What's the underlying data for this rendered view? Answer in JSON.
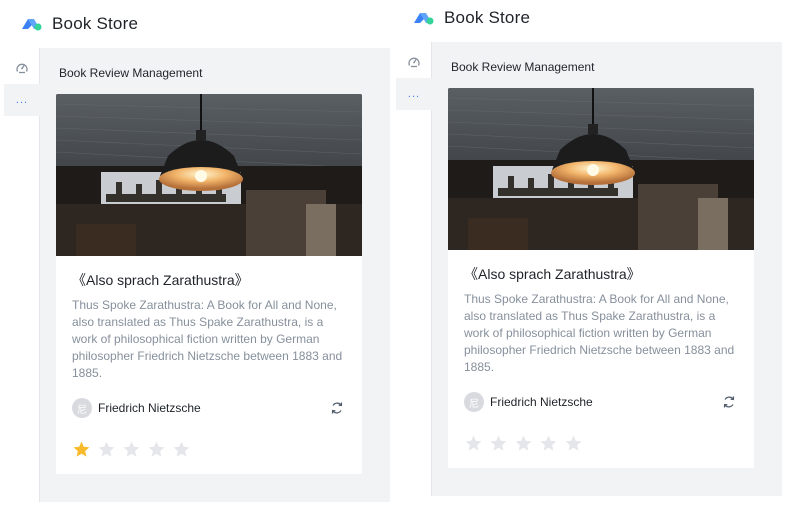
{
  "colors": {
    "accent": "#4e7bf0",
    "star_active": "#f7ba2a",
    "star_inactive": "#e5e6eb",
    "muted_text": "#86909c"
  },
  "panels": [
    {
      "header": {
        "title": "Book Store"
      },
      "sidebar": {
        "items": [
          {
            "icon": "dashboard-icon"
          },
          {
            "icon": "more-dots-icon",
            "label": "..."
          }
        ]
      },
      "main": {
        "page_title": "Book Review Management",
        "card": {
          "title": "《Also sprach Zarathustra》",
          "description": "Thus Spoke Zarathustra: A Book for All and None, also translated as Thus Spake Zarathustra, is a work of philosophical fiction written by German philosopher Friedrich Nietzsche between 1883 and 1885.",
          "author": "Friedrich Nietzsche",
          "avatar_text": "尼",
          "rating": 1,
          "max_rating": 5
        }
      }
    },
    {
      "header": {
        "title": "Book Store"
      },
      "sidebar": {
        "items": [
          {
            "icon": "dashboard-icon"
          },
          {
            "icon": "more-dots-icon",
            "label": "..."
          }
        ]
      },
      "main": {
        "page_title": "Book Review Management",
        "card": {
          "title": "《Also sprach Zarathustra》",
          "description": "Thus Spoke Zarathustra: A Book for All and None, also translated as Thus Spake Zarathustra, is a work of philosophical fiction written by German philosopher Friedrich Nietzsche between 1883 and 1885.",
          "author": "Friedrich Nietzsche",
          "avatar_text": "尼",
          "rating": 0,
          "max_rating": 5
        }
      }
    }
  ]
}
